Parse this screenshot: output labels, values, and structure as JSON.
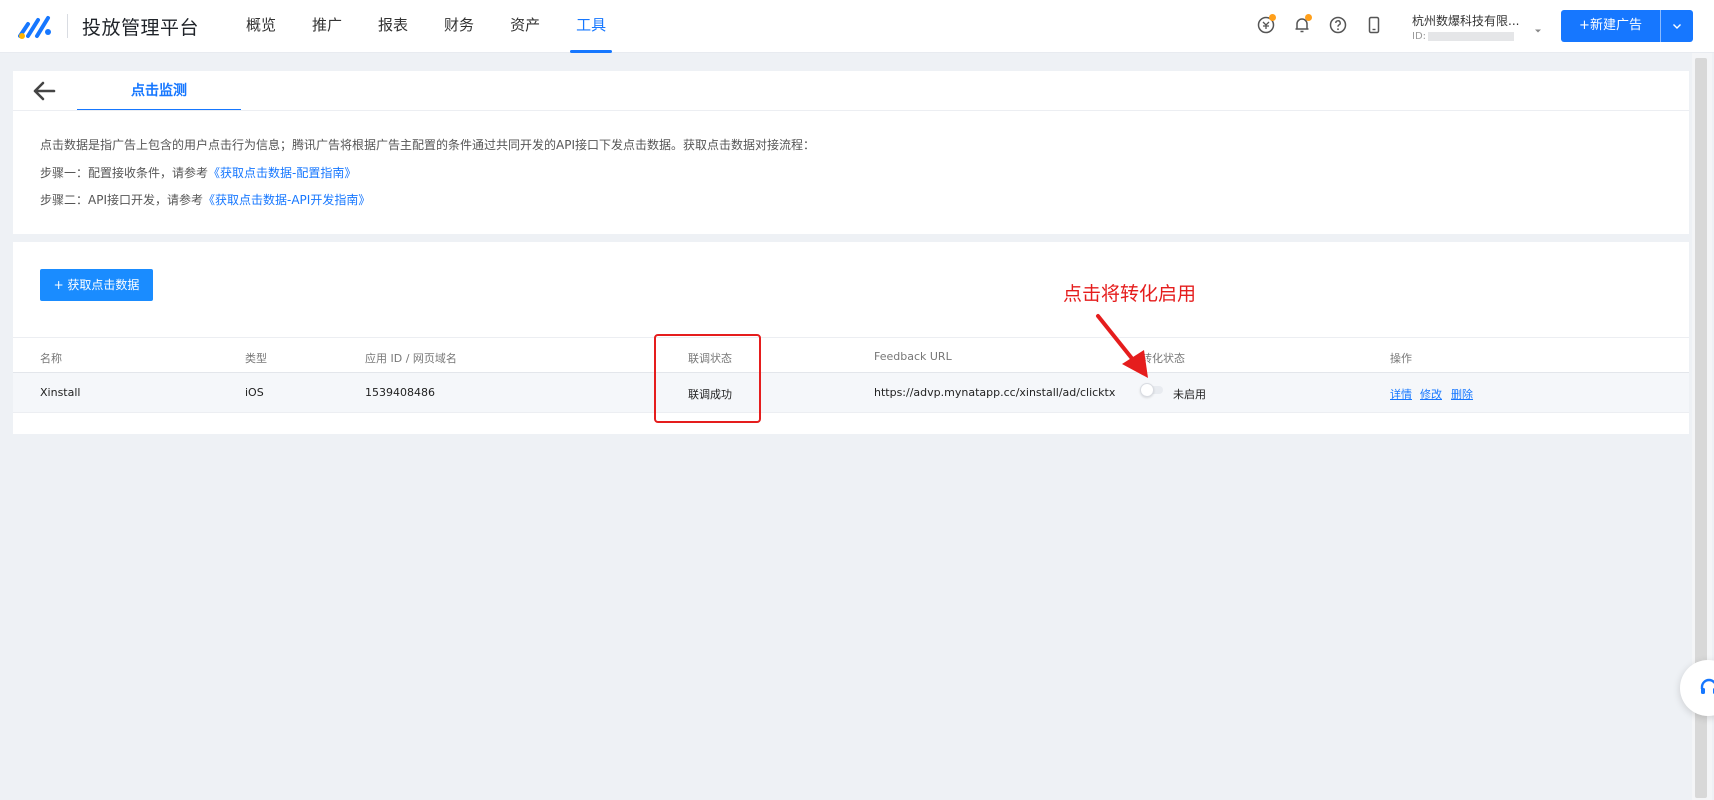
{
  "header": {
    "brand": "投放管理平台",
    "nav": [
      {
        "label": "概览"
      },
      {
        "label": "推广"
      },
      {
        "label": "报表"
      },
      {
        "label": "财务"
      },
      {
        "label": "资产"
      },
      {
        "label": "工具"
      }
    ],
    "active_nav": "工具",
    "account": {
      "name": "杭州数爆科技有限...",
      "id_label": "ID:"
    },
    "new_ad_label": "+新建广告"
  },
  "page": {
    "tab_label": "点击监测",
    "description": "点击数据是指广告上包含的用户点击行为信息；腾讯广告将根据广告主配置的条件通过共同开发的API接口下发点击数据。获取点击数据对接流程：",
    "step1_prefix": "步骤一：配置接收条件，请参考",
    "step1_link": "《获取点击数据-配置指南》",
    "step2_prefix": "步骤二：API接口开发，请参考",
    "step2_link": "《获取点击数据-API开发指南》",
    "get_data_button": "+ 获取点击数据"
  },
  "table": {
    "columns": [
      "名称",
      "类型",
      "应用 ID / 网页域名",
      "联调状态",
      "Feedback URL",
      "转化状态",
      "操作"
    ],
    "rows": [
      {
        "name": "Xinstall",
        "type": "iOS",
        "app_id": "1539408486",
        "debug_status": "联调成功",
        "feedback_url": "https://advp.mynatapp.cc/xinstall/ad/clicktx",
        "conversion_status": "未启用",
        "conversion_enabled": false,
        "actions": [
          "详情",
          "修改",
          "删除"
        ]
      }
    ]
  },
  "annotation": {
    "text": "点击将转化启用",
    "color": "#e51d1d"
  },
  "colors": {
    "primary": "#1677ff",
    "background": "#eef1f5",
    "notification_dot": "#ff9f1a"
  }
}
